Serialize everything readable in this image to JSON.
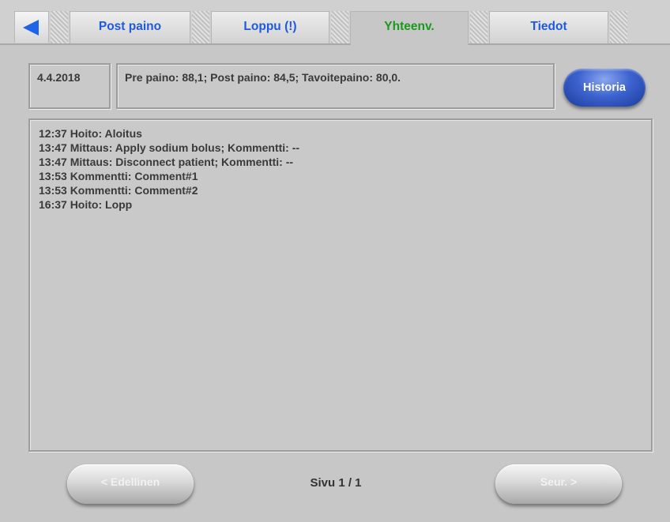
{
  "tabs": [
    {
      "label": "Post paino",
      "active": false
    },
    {
      "label": "Loppu (!)",
      "active": false
    },
    {
      "label": "Yhteenv.",
      "active": true
    },
    {
      "label": "Tiedot",
      "active": false
    }
  ],
  "summary": {
    "date": "4.4.2018",
    "weights": "Pre paino: 88,1; Post paino: 84,5; Tavoitepaino: 80,0."
  },
  "historia_button": "Historia",
  "log_entries": [
    "12:37 Hoito: Aloitus",
    "13:47 Mittaus: Apply sodium bolus; Kommentti: --",
    "13:47 Mittaus: Disconnect patient; Kommentti: --",
    "13:53 Kommentti: Comment#1",
    "13:53 Kommentti: Comment#2",
    "16:37 Hoito: Lopp"
  ],
  "footer": {
    "prev_label": "< Edellinen",
    "page_indicator": "Sivu 1 / 1",
    "next_label": "Seur. >",
    "prev_enabled": false,
    "next_enabled": false
  },
  "colors": {
    "tab_text": "#1f5bd9",
    "active_tab_text": "#1a9a1a",
    "historia_button": "#3d63d0",
    "back_arrow": "#1e64e6"
  },
  "icons": {
    "back": "back-arrow-icon"
  }
}
